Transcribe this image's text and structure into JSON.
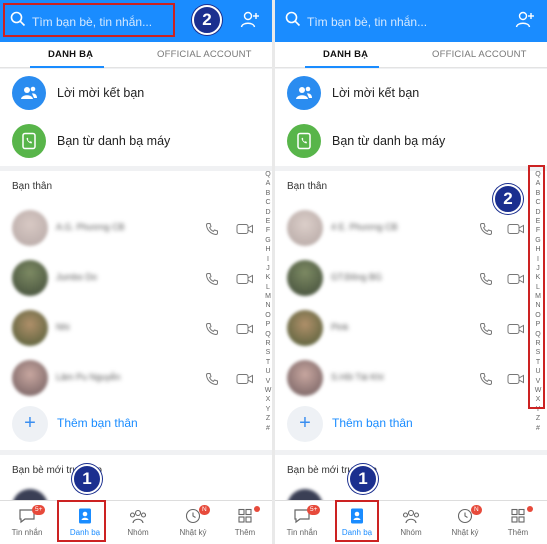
{
  "search": {
    "placeholder_left": "Tìm bạn bè, tin nhắn...",
    "placeholder_right": "Tìm bạn bè, tin nhắn..."
  },
  "tabs": {
    "contacts": "DANH BẠ",
    "official": "OFFICIAL ACCOUNT"
  },
  "quick": {
    "invites": "Lời mời kết bạn",
    "phonebook": "Bạn từ danh bạ máy"
  },
  "close_friends": {
    "title": "Bạn thân",
    "left_names": [
      "A.G. Phương CB",
      "Jumbo Do",
      "Nhi",
      "Lâm Pu Nguyễn"
    ],
    "right_names": [
      "4 E. Phương CB",
      "GT.Đông BG",
      "Pink",
      "S.Hồi Tài Khí"
    ],
    "add_label": "Thêm bạn thân"
  },
  "recent": {
    "title": "Bạn bè mới truy cập"
  },
  "alphabet": [
    "Q",
    "A",
    "B",
    "C",
    "D",
    "E",
    "F",
    "G",
    "H",
    "I",
    "J",
    "K",
    "L",
    "M",
    "N",
    "O",
    "P",
    "Q",
    "R",
    "S",
    "T",
    "U",
    "V",
    "W",
    "X",
    "Y",
    "Z",
    "#"
  ],
  "nav": {
    "messages": "Tin nhắn",
    "contacts": "Danh bạ",
    "groups": "Nhóm",
    "diary": "Nhật ký",
    "more": "Thêm",
    "messages_badge": "5+",
    "diary_badge": "N"
  },
  "annotations": {
    "step1": "1",
    "step2": "2"
  },
  "colors": {
    "primary": "#1a8cff",
    "annotation_red": "#cc2222",
    "annotation_badge": "#1b2f8f"
  }
}
